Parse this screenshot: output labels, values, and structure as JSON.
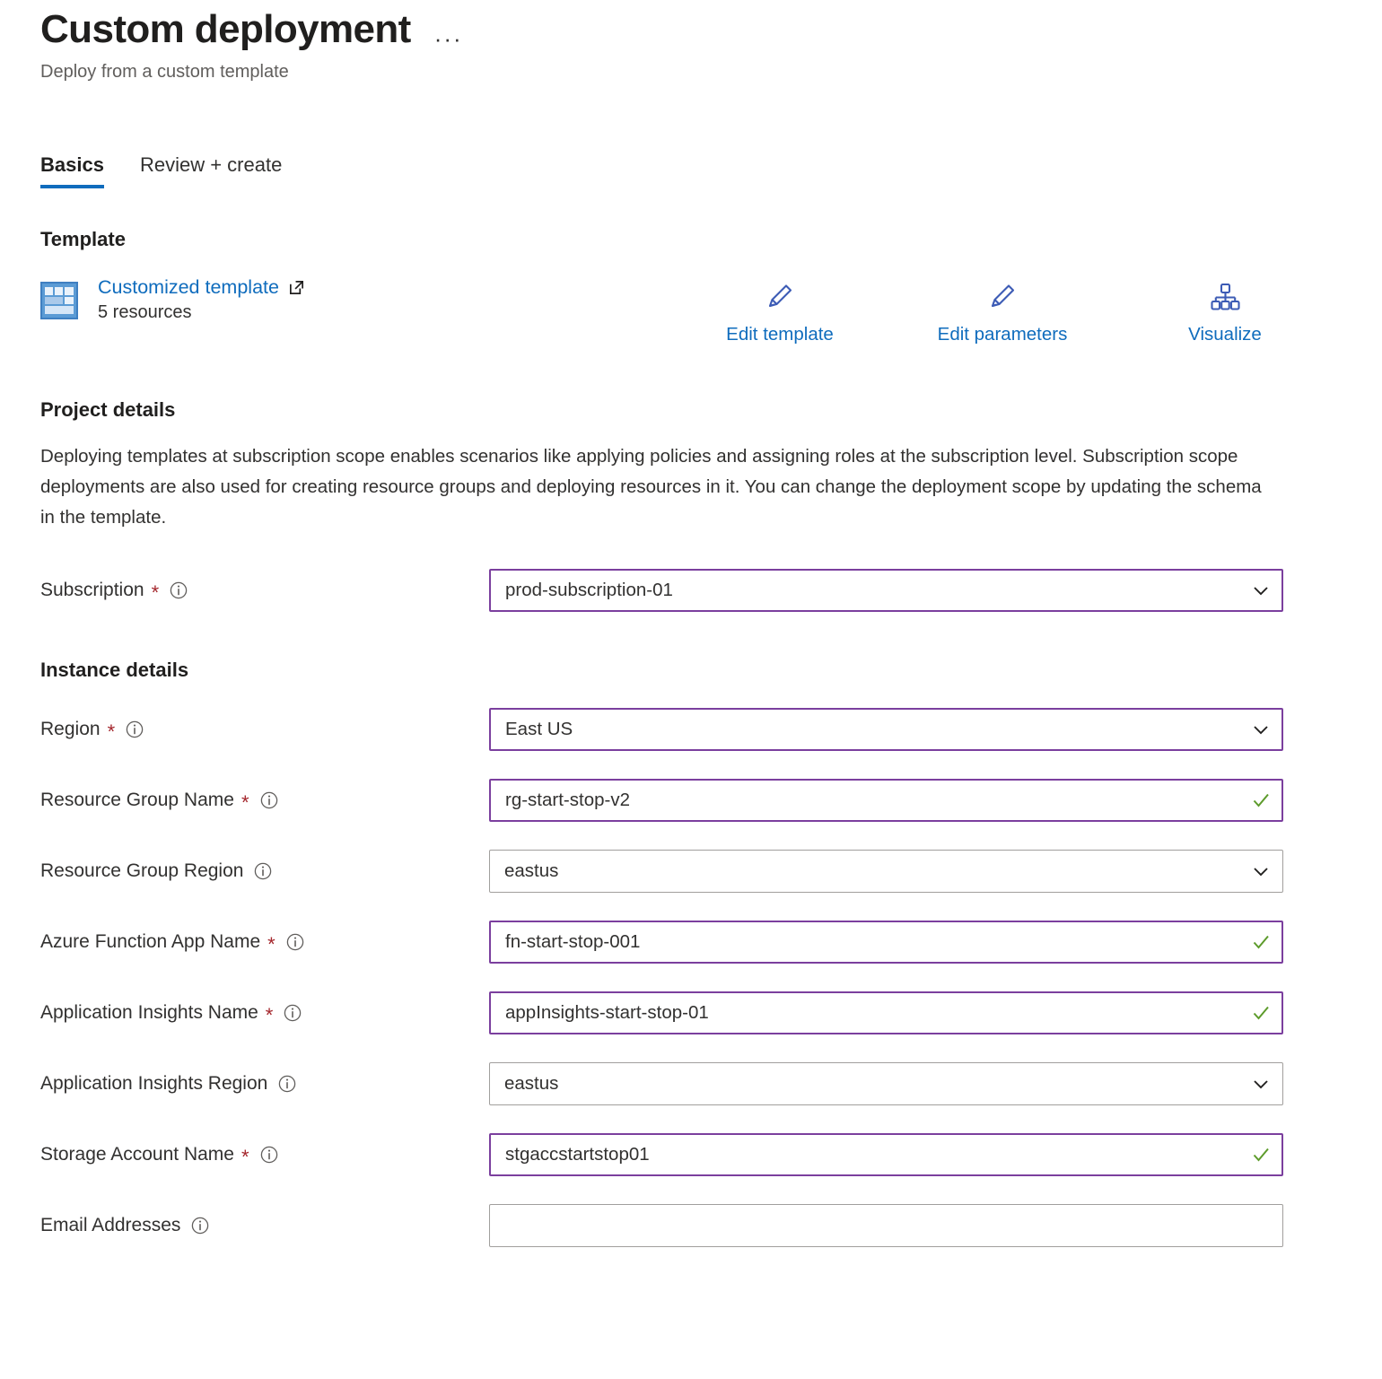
{
  "header": {
    "title": "Custom deployment",
    "subtitle": "Deploy from a custom template",
    "more_label": "···"
  },
  "tabs": [
    {
      "label": "Basics",
      "active": true
    },
    {
      "label": "Review + create",
      "active": false
    }
  ],
  "template": {
    "section_title": "Template",
    "link_label": "Customized template",
    "resource_count": "5 resources",
    "actions": [
      {
        "label": "Edit template",
        "icon": "pencil-icon"
      },
      {
        "label": "Edit parameters",
        "icon": "pencil-icon"
      },
      {
        "label": "Visualize",
        "icon": "hierarchy-icon"
      }
    ]
  },
  "project_details": {
    "section_title": "Project details",
    "description": "Deploying templates at subscription scope enables scenarios like applying policies and assigning roles at the subscription level. Subscription scope deployments are also used for creating resource groups and deploying resources in it. You can change the deployment scope by updating the schema in the template.",
    "subscription": {
      "label": "Subscription",
      "required": true,
      "value": "prod-subscription-01",
      "type": "dropdown",
      "state": "focused"
    }
  },
  "instance_details": {
    "section_title": "Instance details",
    "fields": [
      {
        "label": "Region",
        "required": true,
        "value": "East US",
        "type": "dropdown",
        "state": "focused"
      },
      {
        "label": "Resource Group Name",
        "required": true,
        "value": "rg-start-stop-v2",
        "type": "text",
        "state": "focused",
        "valid": true
      },
      {
        "label": "Resource Group Region",
        "required": false,
        "value": "eastus",
        "type": "dropdown",
        "state": "default"
      },
      {
        "label": "Azure Function App Name",
        "required": true,
        "value": "fn-start-stop-001",
        "type": "text",
        "state": "focused",
        "valid": true
      },
      {
        "label": "Application Insights Name",
        "required": true,
        "value": "appInsights-start-stop-01",
        "type": "text",
        "state": "focused",
        "valid": true
      },
      {
        "label": "Application Insights Region",
        "required": false,
        "value": "eastus",
        "type": "dropdown",
        "state": "default"
      },
      {
        "label": "Storage Account Name",
        "required": true,
        "value": "stgaccstartstop01",
        "type": "text",
        "state": "focused",
        "valid": true
      },
      {
        "label": "Email Addresses",
        "required": false,
        "value": "",
        "type": "text",
        "state": "default",
        "valid": false
      }
    ]
  },
  "colors": {
    "accent_blue": "#0f6cbd",
    "focus_purple": "#7b3f9e",
    "valid_green": "#5d9b2b",
    "required_red": "#a4262c",
    "border_gray": "#a19f9d"
  }
}
